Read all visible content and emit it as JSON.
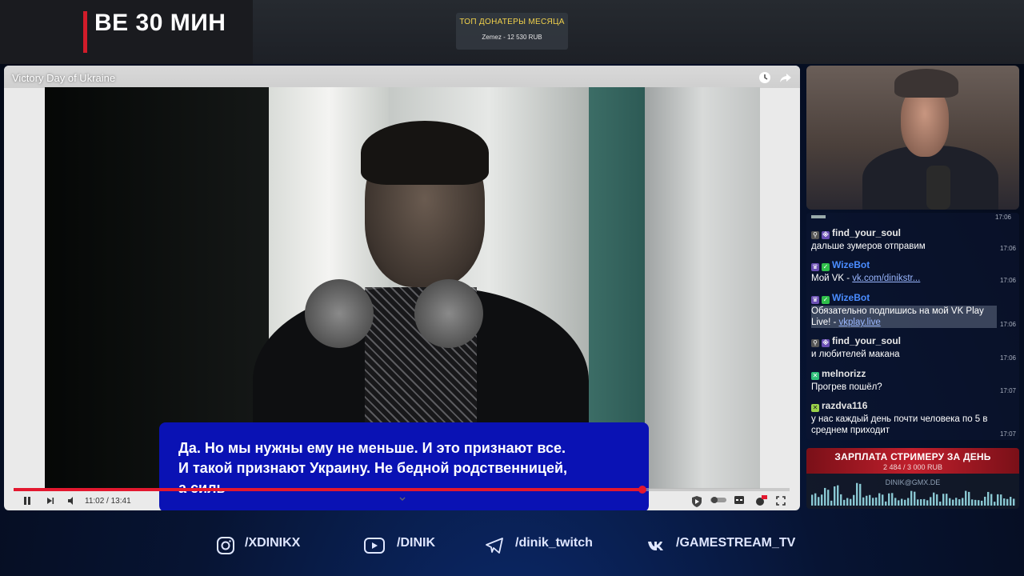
{
  "timer": {
    "text": "ВЕ 30 МИН"
  },
  "donors": {
    "title": "ТОП ДОНАТЕРЫ МЕСЯЦА",
    "entry": "Zemez - 12 530 RUB"
  },
  "player": {
    "title": "Victory Day of Ukraine",
    "subtitle_lines": [
      "Да. Но мы нужны ему не меньше. И это признают все.",
      "И такой признают Украину. Не бедной родственницей,",
      "а силь"
    ],
    "time": "11:02 / 13:41",
    "progress": 0.81
  },
  "chat": {
    "messages": [
      {
        "user": "find_your_soul",
        "user_color": "#e6e6e6",
        "text": "дальше зумеров отправим",
        "time": "17:06"
      },
      {
        "user": "WizeBot",
        "user_color": "#4a8cff",
        "text": "Мой VK - ",
        "link": "vk.com/dinikstr...",
        "time": "17:06"
      },
      {
        "user": "WizeBot",
        "user_color": "#4a8cff",
        "text": "Обязательно подпишись на мой VK Play Live! - ",
        "link": "vkplay.live",
        "time": "17:06"
      },
      {
        "user": "find_your_soul",
        "user_color": "#e6e6e6",
        "text": "и любителей макана",
        "time": "17:06"
      },
      {
        "user": "melnorizz",
        "user_color": "#e6e6e6",
        "text": "Прогрев пошёл?",
        "time": "17:07"
      },
      {
        "user": "razdva116",
        "user_color": "#e6e6e6",
        "text": "у нас каждый день почти человека по 5 в среднем приходит",
        "time": "17:07"
      }
    ],
    "top_time": "17:06"
  },
  "salary": {
    "title": "ЗАРПЛАТА СТРИМЕРУ ЗА ДЕНЬ",
    "amount": "2 484 / 3 000 RUB",
    "email": "DINIK@GMX.DE"
  },
  "socials": [
    {
      "icon": "instagram-icon",
      "label": "/XDINIKX"
    },
    {
      "icon": "youtube-icon",
      "label": "/DINIK"
    },
    {
      "icon": "telegram-icon",
      "label": "/dinik_twitch"
    },
    {
      "icon": "vk-icon",
      "label": "/GAMESTREAM_TV"
    }
  ],
  "colors": {
    "accent_red": "#e3182f",
    "subtitle_bg": "#0a12b4",
    "donor_title": "#f2d24b"
  }
}
